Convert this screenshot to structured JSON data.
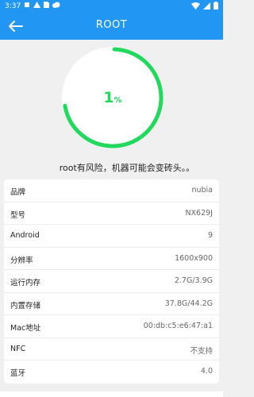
{
  "status_bar": {
    "time": "3:37",
    "icons": [
      "notification-icon",
      "warning-icon",
      "sim-icon",
      "cloud-icon",
      "wifi-icon",
      "signal-icon",
      "battery-icon"
    ]
  },
  "app_bar": {
    "title": "ROOT",
    "back_icon": "arrow-left-icon"
  },
  "progress": {
    "value": "1",
    "unit": "%",
    "fraction": 0.01,
    "color": "#21d95c"
  },
  "warning_text": "root有风险，机器可能会变砖头。。",
  "colors": {
    "primary": "#2196f3",
    "accent": "#21d95c"
  },
  "device_info": [
    {
      "label": "品牌",
      "value": "nubia"
    },
    {
      "label": "型号",
      "value": "NX629J"
    },
    {
      "label": "Android",
      "value": "9"
    },
    {
      "label": "分辨率",
      "value": "1600x900"
    },
    {
      "label": "运行内存",
      "value": "2.7G/3.9G"
    },
    {
      "label": "内置存储",
      "value": "37.8G/44.2G"
    },
    {
      "label": "Mac地址",
      "value": "00:db:c5:e6:47:a1"
    },
    {
      "label": "NFC",
      "value": "不支持"
    },
    {
      "label": "蓝牙",
      "value": "4.0"
    }
  ]
}
